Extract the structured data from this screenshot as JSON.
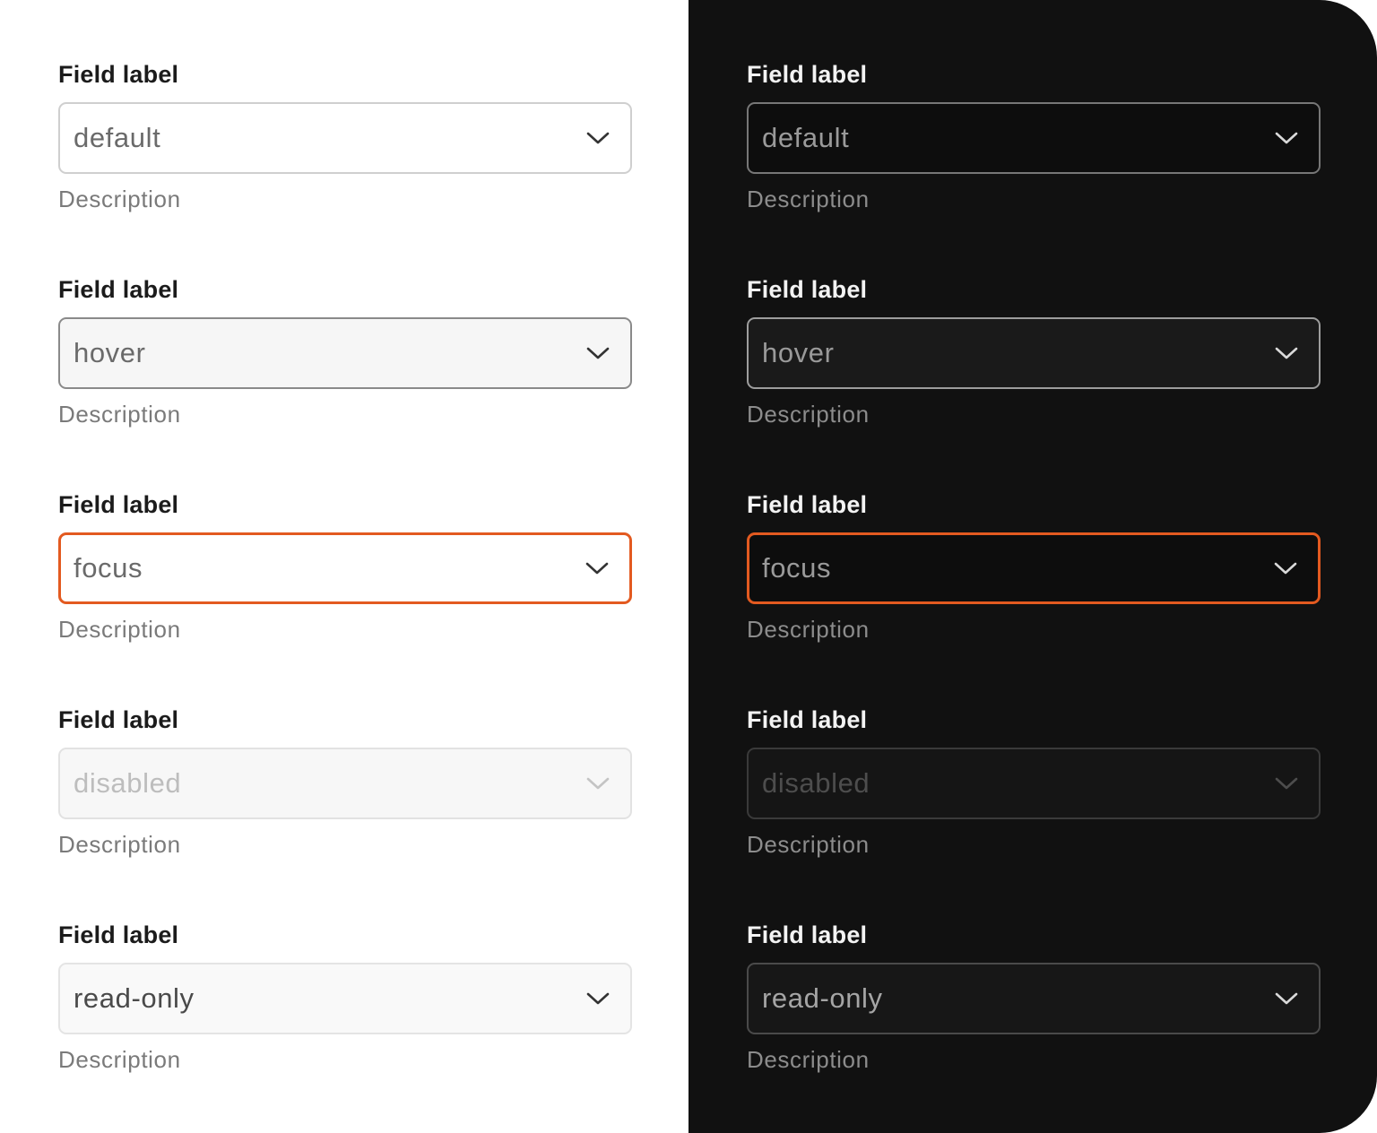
{
  "accent_color": "#e35a20",
  "light_panel": {
    "background": "#ffffff",
    "fields": [
      {
        "label": "Field label",
        "value": "default",
        "description": "Description",
        "state": "default"
      },
      {
        "label": "Field label",
        "value": "hover",
        "description": "Description",
        "state": "hover"
      },
      {
        "label": "Field label",
        "value": "focus",
        "description": "Description",
        "state": "focus"
      },
      {
        "label": "Field label",
        "value": "disabled",
        "description": "Description",
        "state": "disabled"
      },
      {
        "label": "Field label",
        "value": "read-only",
        "description": "Description",
        "state": "read-only"
      }
    ]
  },
  "dark_panel": {
    "background": "#111111",
    "fields": [
      {
        "label": "Field label",
        "value": "default",
        "description": "Description",
        "state": "default"
      },
      {
        "label": "Field label",
        "value": "hover",
        "description": "Description",
        "state": "hover"
      },
      {
        "label": "Field label",
        "value": "focus",
        "description": "Description",
        "state": "focus"
      },
      {
        "label": "Field label",
        "value": "disabled",
        "description": "Description",
        "state": "disabled"
      },
      {
        "label": "Field label",
        "value": "read-only",
        "description": "Description",
        "state": "read-only"
      }
    ]
  },
  "icons": {
    "dropdown": "chevron-down-icon"
  }
}
